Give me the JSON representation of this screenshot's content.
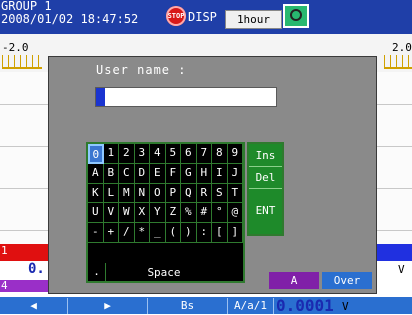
{
  "header": {
    "group": "GROUP 1",
    "datetime": "2008/01/02 18:47:52",
    "stop_icon_text": "STOP",
    "disp": "DISP",
    "timebase": "1hour",
    "colors": {
      "bar": "#1f3fa8",
      "stop": "#d81818",
      "media": "#28b870"
    }
  },
  "scale": {
    "left_value": "-2.0",
    "right_value": "2.0"
  },
  "dialog": {
    "title": "User  name :",
    "field_value": "",
    "keyboard_rows": [
      [
        "0",
        "1",
        "2",
        "3",
        "4",
        "5",
        "6",
        "7",
        "8",
        "9"
      ],
      [
        "A",
        "B",
        "C",
        "D",
        "E",
        "F",
        "G",
        "H",
        "I",
        "J"
      ],
      [
        "K",
        "L",
        "M",
        "N",
        "O",
        "P",
        "Q",
        "R",
        "S",
        "T"
      ],
      [
        "U",
        "V",
        "W",
        "X",
        "Y",
        "Z",
        "%",
        "#",
        "°",
        "@"
      ],
      [
        "-",
        "+",
        "/",
        "*",
        "_",
        "(",
        ")",
        ":",
        "[",
        "]"
      ]
    ],
    "selected_key": "0",
    "bottom_row": {
      "dot": ".",
      "space": "Space"
    },
    "function_keys": [
      "Ins",
      "Del",
      "ENT"
    ],
    "mode_a": "A",
    "mode_over": "Over"
  },
  "channels": {
    "ch1_label": "1",
    "ch1_value": "0.",
    "ch4_label": "4",
    "right_unit": "V"
  },
  "softkeys": {
    "left": "◀",
    "right": "▶",
    "bs": "Bs",
    "aa1": "A/a/1",
    "value": "0.0001",
    "unit": "V"
  }
}
